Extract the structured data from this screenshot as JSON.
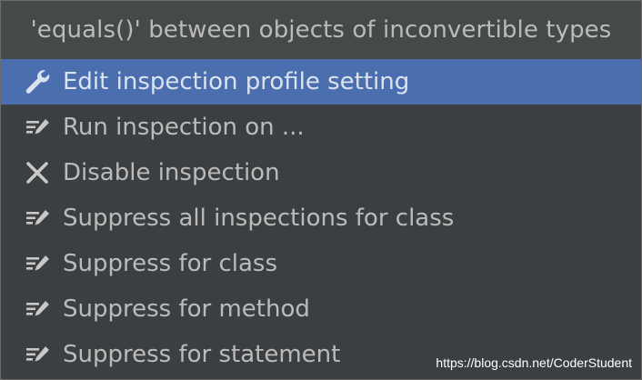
{
  "popup": {
    "title": "'equals()' between objects of inconvertible types"
  },
  "menu": {
    "items": [
      {
        "label": "Edit inspection profile setting",
        "icon": "wrench-icon",
        "selected": true
      },
      {
        "label": "Run inspection on ...",
        "icon": "edit-lines-icon"
      },
      {
        "label": "Disable inspection",
        "icon": "close-icon"
      },
      {
        "label": "Suppress all inspections for class",
        "icon": "edit-lines-icon"
      },
      {
        "label": "Suppress for class",
        "icon": "edit-lines-icon"
      },
      {
        "label": "Suppress for method",
        "icon": "edit-lines-icon"
      },
      {
        "label": "Suppress for statement",
        "icon": "edit-lines-icon"
      }
    ]
  },
  "watermark": {
    "text": "https://blog.csdn.net/CoderStudent"
  },
  "colors": {
    "background": "#3c3f41",
    "header": "#45494a",
    "selection": "#4b6eaf",
    "text": "#bbbbbb"
  }
}
